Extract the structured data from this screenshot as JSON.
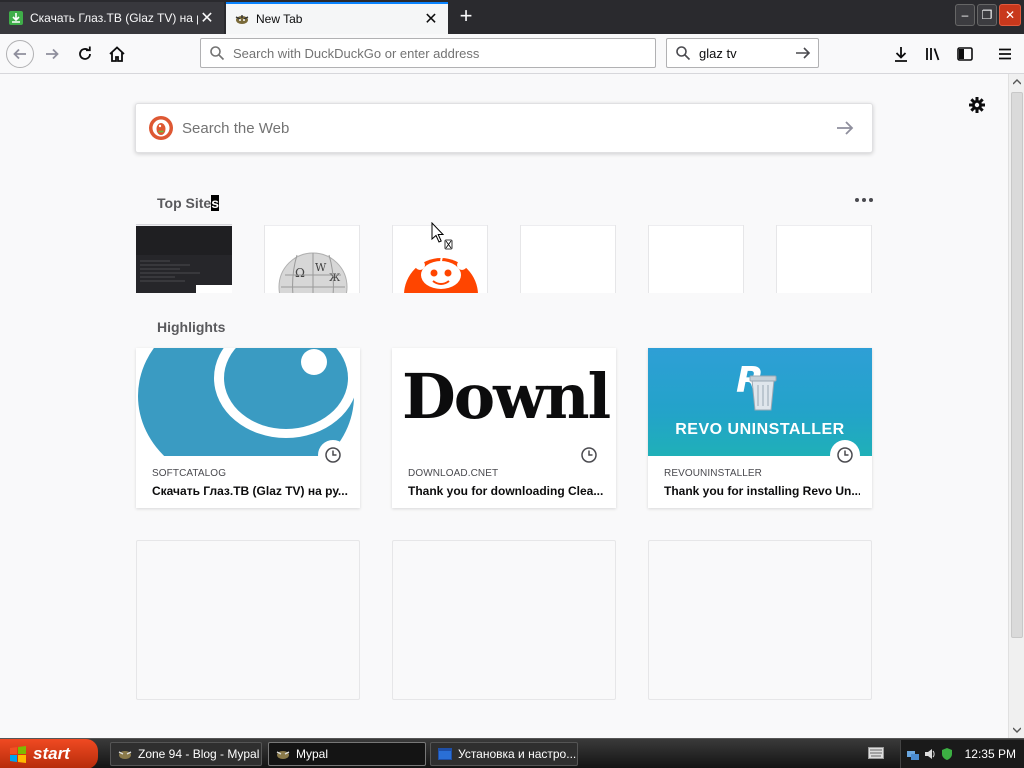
{
  "tabs": [
    {
      "title": "Скачать Глаз.ТВ (Glaz TV) на ру",
      "close_label": "✕",
      "active": false
    },
    {
      "title": "New Tab",
      "close_label": "✕",
      "active": true
    }
  ],
  "new_tab_label": "+",
  "window_controls": {
    "minimize": "‒",
    "maximize": "❐",
    "close": "✕"
  },
  "navbar": {
    "url_placeholder": "Search with DuckDuckGo or enter address",
    "search_value": "glaz tv"
  },
  "newtab": {
    "web_search_placeholder": "Search the Web",
    "top_sites_title": "Top Site",
    "top_sites_title_caret": "s",
    "highlights_title": "Highlights",
    "highlights": [
      {
        "host": "SOFTCATALOG",
        "title": "Скачать Глаз.ТВ (Glaz TV) на ру..."
      },
      {
        "host": "DOWNLOAD.CNET",
        "title": "Thank you for downloading Clea...",
        "thumb_text": "Downl"
      },
      {
        "host": "REVOUNINSTALLER",
        "title": "Thank you for installing Revo Un...",
        "thumb_text": "REVO UNINSTALLER"
      }
    ]
  },
  "taskbar": {
    "start_label": "start",
    "tasks": [
      {
        "label": "Zone 94 - Blog - Mypal"
      },
      {
        "label": "Mypal",
        "active": true
      },
      {
        "label": "Установка и настро..."
      }
    ],
    "clock": "12:35 PM"
  },
  "colors": {
    "accent": "#0a84ff",
    "reddit": "#ff4500",
    "revo_bg": "#2aa1d8",
    "softcatalog": "#3a9bc2",
    "start": "#d8431c"
  }
}
